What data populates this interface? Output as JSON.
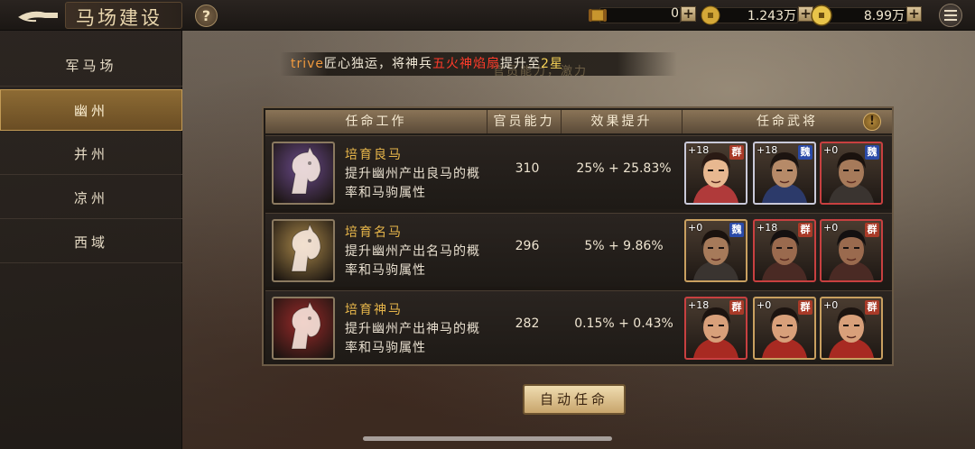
{
  "header": {
    "title": "马场建设",
    "help_label": "?",
    "resources": [
      {
        "name": "scroll",
        "value": "0",
        "plus": "+"
      },
      {
        "name": "copper-coin",
        "value": "1.243万",
        "plus": "+"
      },
      {
        "name": "gold-coin",
        "value": "8.99万",
        "plus": "+"
      }
    ]
  },
  "sidebar": {
    "items": [
      {
        "label": "军马场",
        "active": false
      },
      {
        "label": "幽州",
        "active": true
      },
      {
        "label": "并州",
        "active": false
      },
      {
        "label": "凉州",
        "active": false
      },
      {
        "label": "西域",
        "active": false
      }
    ]
  },
  "marquee": {
    "player": "trive",
    "part1": "匠心独运，将神兵",
    "item": "五火神焰扇",
    "part2": "提升至",
    "star": "2星",
    "ghost": "官员能力，激力"
  },
  "table": {
    "headers": [
      "任命工作",
      "官员能力",
      "效果提升",
      "任命武将"
    ],
    "warn": "!",
    "rows": [
      {
        "name": "培育良马",
        "desc": "提升幽州产出良马的概率和马驹属性",
        "ability": "310",
        "effect": "25% + 25.83%",
        "horse_color": "#6a4a8a",
        "generals": [
          {
            "level": "+18",
            "faction": "群",
            "faction_color": "#a83a28",
            "frame": "#c9c9d9",
            "skin": "#e8b890",
            "hair": "#2a1a14",
            "robe": "#b03a3a"
          },
          {
            "level": "+18",
            "faction": "魏",
            "faction_color": "#2a4aa8",
            "frame": "#c9c9d9",
            "skin": "#b68a68",
            "hair": "#1c1410",
            "robe": "#2c3a6a"
          },
          {
            "level": "+0",
            "faction": "魏",
            "faction_color": "#2a4aa8",
            "frame": "#c84040",
            "skin": "#a67a5a",
            "hair": "#1a120e",
            "robe": "#3a3430"
          }
        ]
      },
      {
        "name": "培育名马",
        "desc": "提升幽州产出名马的概率和马驹属性",
        "ability": "296",
        "effect": "5% + 9.86%",
        "horse_color": "#a8874a",
        "generals": [
          {
            "level": "+0",
            "faction": "魏",
            "faction_color": "#2a4aa8",
            "frame": "#c9a060",
            "skin": "#a67a5a",
            "hair": "#1a120e",
            "robe": "#3a3430"
          },
          {
            "level": "+18",
            "faction": "群",
            "faction_color": "#a83a28",
            "frame": "#c84040",
            "skin": "#9a6a4e",
            "hair": "#141010",
            "robe": "#4a2a24"
          },
          {
            "level": "+0",
            "faction": "群",
            "faction_color": "#a83a28",
            "frame": "#c84040",
            "skin": "#9a6a4e",
            "hair": "#141010",
            "robe": "#4a2a24"
          }
        ]
      },
      {
        "name": "培育神马",
        "desc": "提升幽州产出神马的概率和马驹属性",
        "ability": "282",
        "effect": "0.15% + 0.43%",
        "horse_color": "#9a2a2a",
        "generals": [
          {
            "level": "+18",
            "faction": "群",
            "faction_color": "#a83a28",
            "frame": "#c84040",
            "skin": "#d8a07a",
            "hair": "#1c1410",
            "robe": "#a82a22"
          },
          {
            "level": "+0",
            "faction": "群",
            "faction_color": "#a83a28",
            "frame": "#c9a060",
            "skin": "#d8a07a",
            "hair": "#1c1410",
            "robe": "#a82a22"
          },
          {
            "level": "+0",
            "faction": "群",
            "faction_color": "#a83a28",
            "frame": "#c9a060",
            "skin": "#d8a07a",
            "hair": "#1c1410",
            "robe": "#a82a22"
          }
        ]
      }
    ]
  },
  "auto_button": "自动任命"
}
